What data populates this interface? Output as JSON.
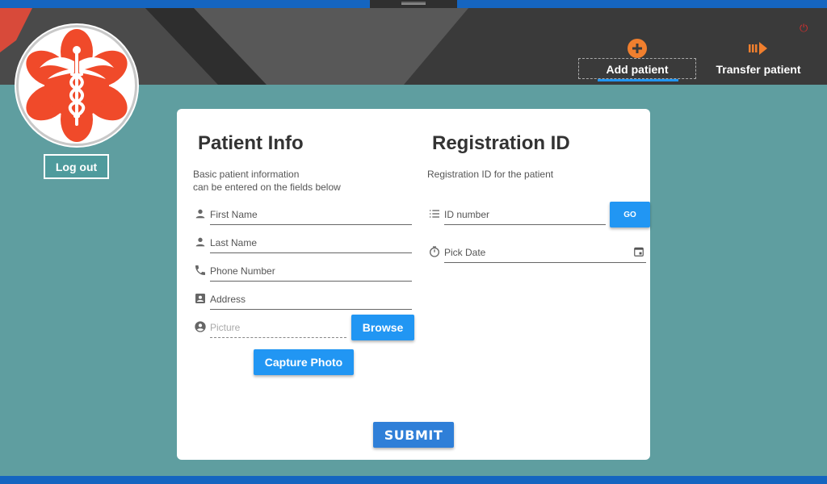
{
  "header": {
    "nav": [
      {
        "label": "Add patient",
        "icon": "plus-circle-icon",
        "active": true
      },
      {
        "label": "Transfer patient",
        "icon": "transfer-arrow-icon",
        "active": false
      }
    ],
    "logout_label": "Log out",
    "accent_color": "#2196f3",
    "icon_color": "#f07f2e"
  },
  "patient_info": {
    "title": "Patient Info",
    "subtitle_line1": "Basic patient information",
    "subtitle_line2": "can be entered on the fields below",
    "fields": [
      {
        "placeholder": "First Name",
        "icon": "person-icon"
      },
      {
        "placeholder": "Last Name",
        "icon": "person-icon"
      },
      {
        "placeholder": "Phone Number",
        "icon": "phone-icon"
      },
      {
        "placeholder": "Address",
        "icon": "contact-card-icon"
      },
      {
        "placeholder": "Picture",
        "icon": "account-circle-icon"
      }
    ],
    "browse_label": "Browse",
    "capture_label": "Capture Photo"
  },
  "registration": {
    "title": "Registration ID",
    "subtitle": "Registration ID for the patient",
    "id_placeholder": "ID number",
    "go_label": "GO",
    "date_placeholder": "Pick Date"
  },
  "submit_label": "SUBMIT"
}
